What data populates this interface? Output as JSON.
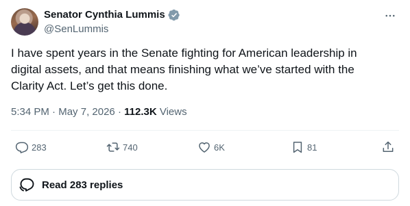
{
  "author": {
    "display_name": "Senator Cynthia Lummis",
    "handle": "@SenLummis",
    "verified_color": "#829aab"
  },
  "tweet": {
    "text": "I have spent years in the Senate fighting for American leadership in\ndigital assets, and that means finishing what we’ve started with the\nClarity Act. Let’s get this done.",
    "time": "5:34 PM",
    "separator": "·",
    "date": "May 7, 2026",
    "views_count": "112.3K",
    "views_label": "Views"
  },
  "actions": {
    "replies": "283",
    "reposts": "740",
    "likes": "6K",
    "bookmarks": "81"
  },
  "read_replies_label": "Read 283 replies",
  "colors": {
    "text_primary": "#0f1419",
    "text_secondary": "#536471",
    "border": "#cfd9de"
  }
}
